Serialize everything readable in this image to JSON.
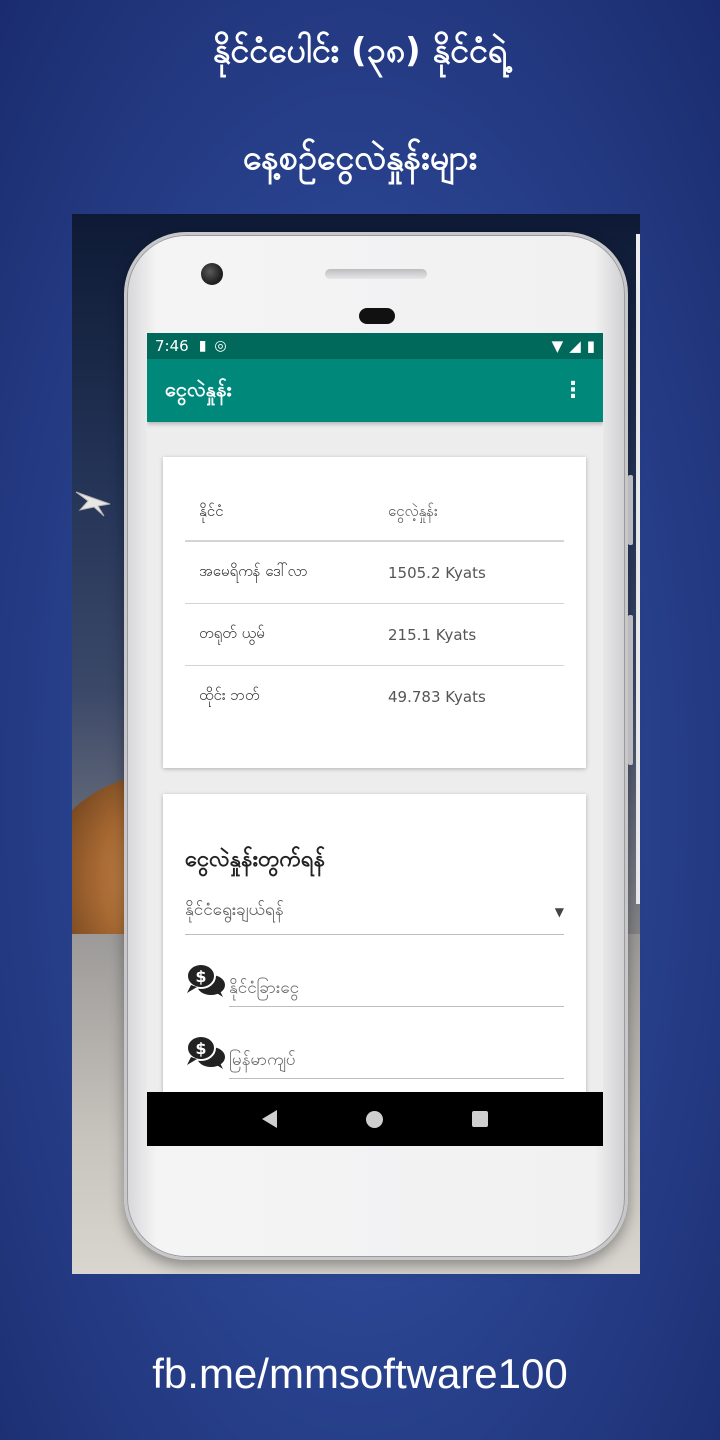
{
  "banner": {
    "line1": "နိုင်ငံပေါင်း (၃၈) နိုင်ငံရဲ့",
    "line2": "နေ့စဉ်ငွေလဲနှုန်းများ"
  },
  "status_bar": {
    "time": "7:46"
  },
  "app_bar": {
    "title": "ငွေလဲနှုန်း",
    "menu_icon": "⋮"
  },
  "rates_table": {
    "headers": [
      "နိုင်ငံ",
      "ငွေလဲ့နှုန်း"
    ],
    "rows": [
      {
        "country": "အမေရိကန် ဒေါ်လာ",
        "rate": "1505.2 Kyats"
      },
      {
        "country": "တရုတ် ယွမ်",
        "rate": "215.1 Kyats"
      },
      {
        "country": "ထိုင်း ဘတ်",
        "rate": "49.783 Kyats"
      }
    ]
  },
  "calculator": {
    "heading": "ငွေလဲနှုန်းတွက်ရန်",
    "country_select": "နိုင်ငံရွေးချယ်ရန်",
    "foreign_field_placeholder": "နိုင်ငံခြားငွေ",
    "kyat_field_placeholder": "မြန်မာကျပ်"
  },
  "footer": {
    "text": "fb.me/mmsoftware100"
  },
  "colors": {
    "status_bar": "#00695c",
    "app_bar": "#00897b",
    "background": "#2b4592"
  },
  "icons": {
    "money": "money-chat-icon",
    "back": "nav-back-icon",
    "home": "nav-home-icon",
    "recent": "nav-recent-icon"
  }
}
